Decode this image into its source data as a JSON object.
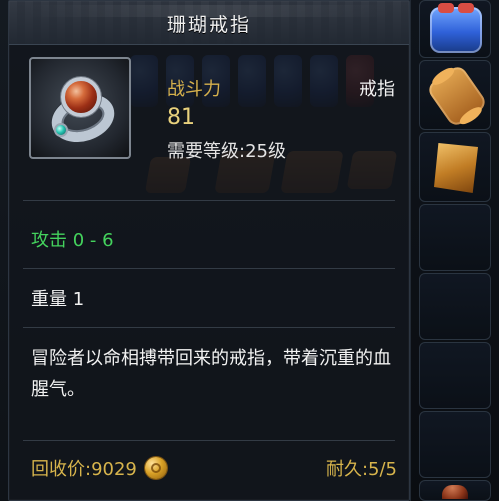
{
  "tooltip": {
    "title": "珊瑚戒指",
    "power_label": "战斗力",
    "power_value": "81",
    "item_type": "戒指",
    "required_level": "需要等级:25级",
    "attack": "攻击 0 - 6",
    "weight": "重量 1",
    "description": "冒险者以命相搏带回来的戒指，带着沉重的血腥气。",
    "price": "回收价:9029",
    "durability": "耐久:5/5"
  },
  "icons": {
    "item": "ring-icon",
    "currency": "gold-coin-icon",
    "side": [
      "potion-icon",
      "scroll-icon",
      "map-icon",
      "slot-icon"
    ]
  },
  "colors": {
    "gold_text": "#d6b14c",
    "green_text": "#44d35d",
    "white_text": "#f2f2f2",
    "panel_bg": "#12161c"
  }
}
